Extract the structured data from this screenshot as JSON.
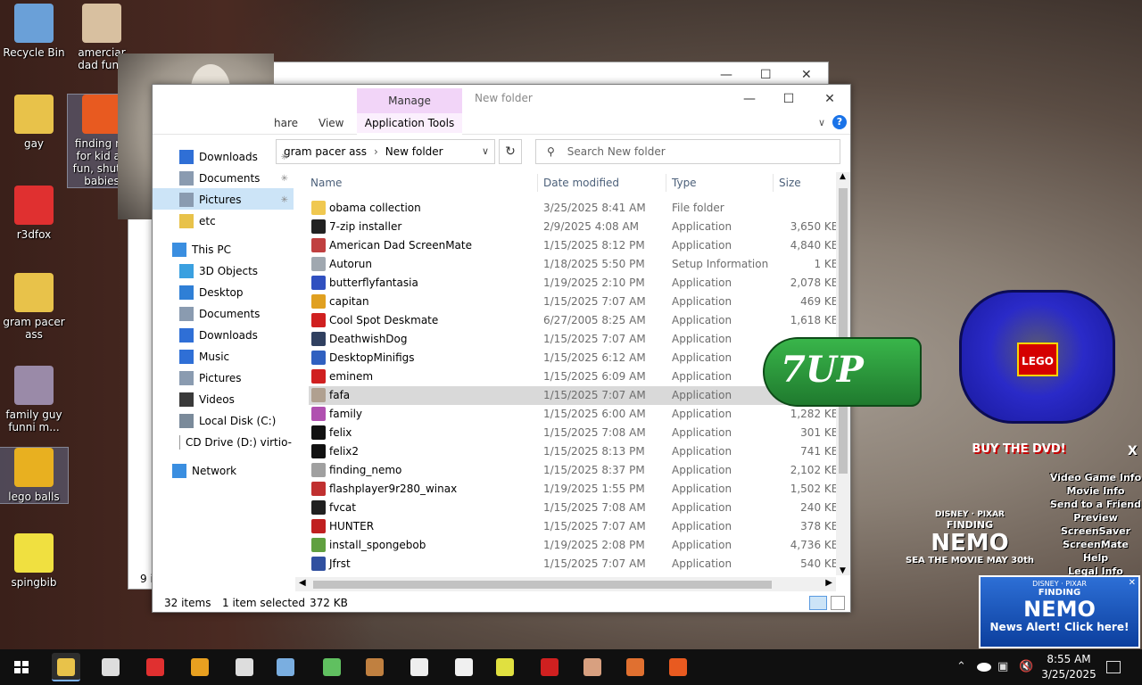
{
  "desktop_icons": [
    {
      "label": "Recycle Bin",
      "color": "#6aa0d8"
    },
    {
      "label": "amerciar dad funn",
      "color": "#d8c0a0"
    },
    {
      "label": "gay",
      "color": "#e8c24a"
    },
    {
      "label": "finding ne for kid an fun, shut u babies",
      "color": "#e85a20"
    },
    {
      "label": "r3dfox",
      "color": "#e03030"
    },
    {
      "label": "gram pacer ass",
      "color": "#e8c24a"
    },
    {
      "label": "family guy funni m...",
      "color": "#9a8aa8"
    },
    {
      "label": "lego balls",
      "color": "#e8b020"
    },
    {
      "label": "spingbib",
      "color": "#f0e040"
    }
  ],
  "back_window": {
    "count_text": "9 i"
  },
  "explorer": {
    "manage_tab": "Manage",
    "title": "New folder",
    "ribbon_tabs": [
      "hare",
      "View"
    ],
    "app_tools": "Application Tools",
    "help": "?",
    "breadcrumb": [
      "gram pacer ass",
      "New folder"
    ],
    "search_placeholder": "Search New folder",
    "nav": [
      {
        "label": "Downloads",
        "pinned": true,
        "color": "#2f6fd6"
      },
      {
        "label": "Documents",
        "pinned": true,
        "color": "#8a9bb0"
      },
      {
        "label": "Pictures",
        "pinned": true,
        "color": "#8a9bb0"
      },
      {
        "label": "etc",
        "pinned": false,
        "color": "#e8c24a"
      },
      {
        "label": "This PC",
        "pinned": false,
        "color": "#3a8ee0"
      },
      {
        "label": "3D Objects",
        "pinned": false,
        "color": "#3aa0e0"
      },
      {
        "label": "Desktop",
        "pinned": false,
        "color": "#2f7fd6"
      },
      {
        "label": "Documents",
        "pinned": false,
        "color": "#8a9bb0"
      },
      {
        "label": "Downloads",
        "pinned": false,
        "color": "#2f6fd6"
      },
      {
        "label": "Music",
        "pinned": false,
        "color": "#2f6fd6"
      },
      {
        "label": "Pictures",
        "pinned": false,
        "color": "#8a9bb0"
      },
      {
        "label": "Videos",
        "pinned": false,
        "color": "#3a3a3a"
      },
      {
        "label": "Local Disk (C:)",
        "pinned": false,
        "color": "#7a8a9a"
      },
      {
        "label": "CD Drive (D:) virtio-",
        "pinned": false,
        "color": "#9a9a9a"
      },
      {
        "label": "Network",
        "pinned": false,
        "color": "#3a8ee0"
      }
    ],
    "columns": {
      "name": "Name",
      "date": "Date modified",
      "type": "Type",
      "size": "Size"
    },
    "files": [
      {
        "name": "obama collection",
        "date": "3/25/2025 8:41 AM",
        "type": "File folder",
        "size": "",
        "color": "#f0c850"
      },
      {
        "name": "7-zip installer",
        "date": "2/9/2025 4:08 AM",
        "type": "Application",
        "size": "3,650 KB",
        "color": "#222222"
      },
      {
        "name": "American Dad ScreenMate",
        "date": "1/15/2025 8:12 PM",
        "type": "Application",
        "size": "4,840 KB",
        "color": "#c04040"
      },
      {
        "name": "Autorun",
        "date": "1/18/2025 5:50 PM",
        "type": "Setup Information",
        "size": "1 KB",
        "color": "#a0a8b0"
      },
      {
        "name": "butterflyfantasia",
        "date": "1/19/2025 2:10 PM",
        "type": "Application",
        "size": "2,078 KB",
        "color": "#3050c0"
      },
      {
        "name": "capitan",
        "date": "1/15/2025 7:07 AM",
        "type": "Application",
        "size": "469 KB",
        "color": "#e0a020"
      },
      {
        "name": "Cool Spot Deskmate",
        "date": "6/27/2005 8:25 AM",
        "type": "Application",
        "size": "1,618 KB",
        "color": "#d02020"
      },
      {
        "name": "DeathwishDog",
        "date": "1/15/2025 7:07 AM",
        "type": "Application",
        "size": "",
        "color": "#304060"
      },
      {
        "name": "DesktopMinifigs",
        "date": "1/15/2025 6:12 AM",
        "type": "Application",
        "size": "",
        "color": "#3060c0"
      },
      {
        "name": "eminem",
        "date": "1/15/2025 6:09 AM",
        "type": "Application",
        "size": "",
        "color": "#d02020"
      },
      {
        "name": "fafa",
        "date": "1/15/2025 7:07 AM",
        "type": "Application",
        "size": "",
        "color": "#b0a090"
      },
      {
        "name": "family",
        "date": "1/15/2025 6:00 AM",
        "type": "Application",
        "size": "1,282 KB",
        "color": "#b050b0"
      },
      {
        "name": "felix",
        "date": "1/15/2025 7:08 AM",
        "type": "Application",
        "size": "301 KB",
        "color": "#111111"
      },
      {
        "name": "felix2",
        "date": "1/15/2025 8:13 PM",
        "type": "Application",
        "size": "741 KB",
        "color": "#111111"
      },
      {
        "name": "finding_nemo",
        "date": "1/15/2025 8:37 PM",
        "type": "Application",
        "size": "2,102 KB",
        "color": "#a0a0a0"
      },
      {
        "name": "flashplayer9r280_winax",
        "date": "1/19/2025 1:55 PM",
        "type": "Application",
        "size": "1,502 KB",
        "color": "#c03030"
      },
      {
        "name": "fvcat",
        "date": "1/15/2025 7:08 AM",
        "type": "Application",
        "size": "240 KB",
        "color": "#202020"
      },
      {
        "name": "HUNTER",
        "date": "1/15/2025 7:07 AM",
        "type": "Application",
        "size": "378 KB",
        "color": "#c02020"
      },
      {
        "name": "install_spongebob",
        "date": "1/19/2025 2:08 PM",
        "type": "Application",
        "size": "4,736 KB",
        "color": "#60a040"
      },
      {
        "name": "Jfrst",
        "date": "1/15/2025 7:07 AM",
        "type": "Application",
        "size": "540 KB",
        "color": "#3050a0"
      }
    ],
    "selected_index": 10,
    "status_items": "32 items",
    "status_selected": "1 item selected",
    "status_size": "372 KB"
  },
  "overlays": {
    "sevenup": "7UP",
    "lego": "LEGO",
    "buy_dvd": "BUY THE DVD!",
    "nemo_menu": [
      "Video Game Info",
      "Movie Info",
      "Send to a Friend",
      "Preview ScreenSaver",
      "ScreenMate Help",
      "Legal Info",
      "Exit"
    ],
    "nemo_logo": [
      "DISNEY · PIXAR",
      "FINDING",
      "NEMO",
      "SEA THE MOVIE MAY 30th"
    ],
    "news_box": [
      "DISNEY · PIXAR",
      "FINDING",
      "NEMO",
      "News Alert! Click here!"
    ],
    "close": "X"
  },
  "taskbar": {
    "apps": [
      {
        "name": "start-button",
        "color": "#ffffff"
      },
      {
        "name": "file-explorer",
        "color": "#e8c24a"
      },
      {
        "name": "settings",
        "color": "#dddddd"
      },
      {
        "name": "r3dfox",
        "color": "#e03030"
      },
      {
        "name": "media",
        "color": "#e8a020"
      },
      {
        "name": "7zip",
        "color": "#dddddd"
      },
      {
        "name": "notepad",
        "color": "#7aaee0"
      },
      {
        "name": "family-guy",
        "color": "#60c060"
      },
      {
        "name": "lego",
        "color": "#c08040"
      },
      {
        "name": "felix",
        "color": "#eeeeee"
      },
      {
        "name": "hello-kitty",
        "color": "#f0f0f0"
      },
      {
        "name": "spongebob",
        "color": "#e0e040"
      },
      {
        "name": "eminem",
        "color": "#d02020"
      },
      {
        "name": "american-dad",
        "color": "#d8a080"
      },
      {
        "name": "hotdog",
        "color": "#e07030"
      },
      {
        "name": "nemo",
        "color": "#e85a20"
      }
    ],
    "time": "8:55 AM",
    "date": "3/25/2025"
  }
}
